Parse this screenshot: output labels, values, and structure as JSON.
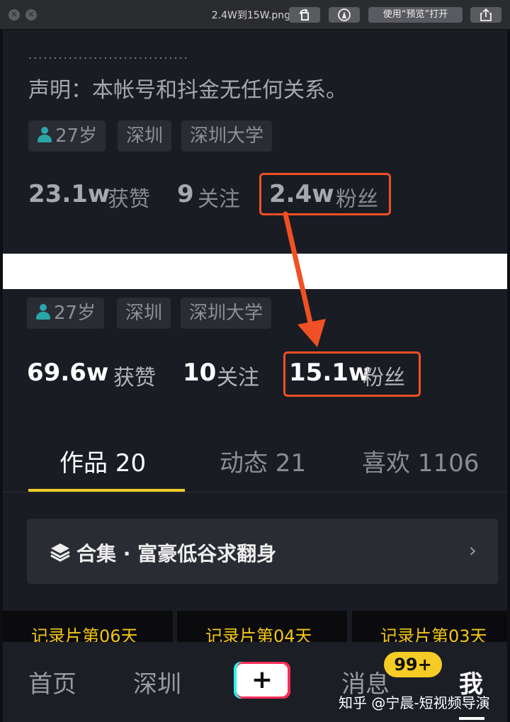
{
  "window": {
    "filename": "2.4W到15W.png",
    "open_with_label": "使用“预览”打开"
  },
  "profile_old": {
    "dots": "................................",
    "statement": "声明：本帐号和抖金无任何关系。",
    "tags": [
      "27岁",
      "深圳",
      "深圳大学"
    ],
    "likes_num": "23.1w",
    "likes_label": "获赞",
    "follow_num": "9",
    "follow_label": "关注",
    "fans_num": "2.4w",
    "fans_label": "粉丝"
  },
  "profile_new": {
    "tags": [
      "27岁",
      "深圳",
      "深圳大学"
    ],
    "likes_num": "69.6w",
    "likes_label": "获赞",
    "follow_num": "10",
    "follow_label": "关注",
    "fans_num": "15.1w",
    "fans_label": "粉丝"
  },
  "tabs": [
    {
      "label": "作品 20"
    },
    {
      "label": "动态 21"
    },
    {
      "label": "喜欢 1106"
    }
  ],
  "collection": {
    "label": "合集 · 富豪低谷求翻身"
  },
  "thumbnails": [
    "记录片第06天",
    "记录片第04天",
    "记录片第03天"
  ],
  "nav": {
    "home": "首页",
    "city": "深圳",
    "plus": "+",
    "messages": "消息",
    "badge": "99+",
    "me": "我"
  },
  "watermark": "知乎 @宁晨-短视频导演",
  "colors": {
    "highlight": "#f05023",
    "tab_indicator": "#f4cc25",
    "badge": "#f4cc25",
    "background": "#1a1c24"
  }
}
